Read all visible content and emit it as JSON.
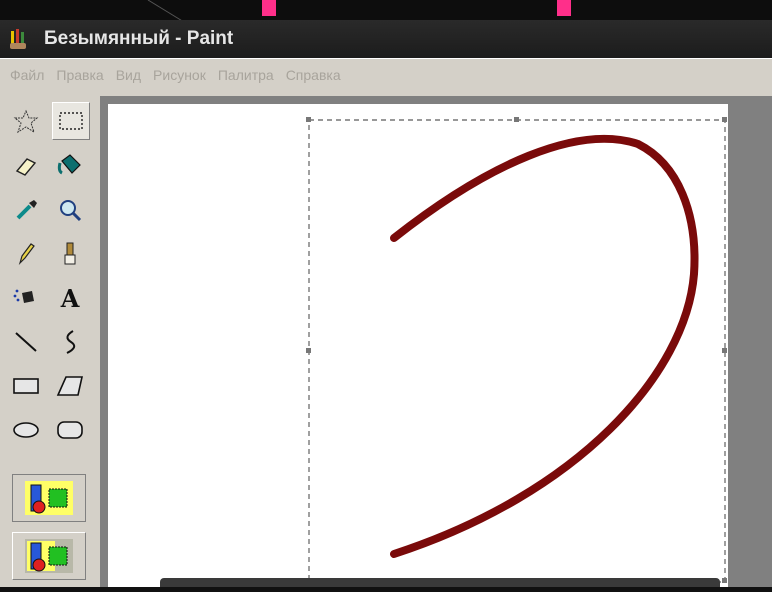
{
  "window": {
    "title": "Безымянный - Paint",
    "icon": "paint-palette-icon"
  },
  "menu": {
    "items": [
      "Файл",
      "Правка",
      "Вид",
      "Рисунок",
      "Палитра",
      "Справка"
    ]
  },
  "toolbox": {
    "tools": [
      "free-form-select-icon",
      "select-icon",
      "eraser-icon",
      "fill-with-color-icon",
      "pick-color-icon",
      "magnifier-icon",
      "pencil-icon",
      "brush-icon",
      "airbrush-icon",
      "text-icon",
      "line-icon",
      "curve-icon",
      "rectangle-icon",
      "polygon-icon",
      "ellipse-icon",
      "rounded-rectangle-icon"
    ],
    "active_tool": "select-icon",
    "text_tool_glyph": "A",
    "option_modes": [
      "opaque-selection-icon",
      "transparent-selection-icon"
    ]
  },
  "canvas": {
    "stroke_color": "#7a0a0a",
    "selection": "dashed-rectangle"
  },
  "colors": {
    "accent_pink": "#ff2f8a",
    "face": "#d4d0c8"
  }
}
